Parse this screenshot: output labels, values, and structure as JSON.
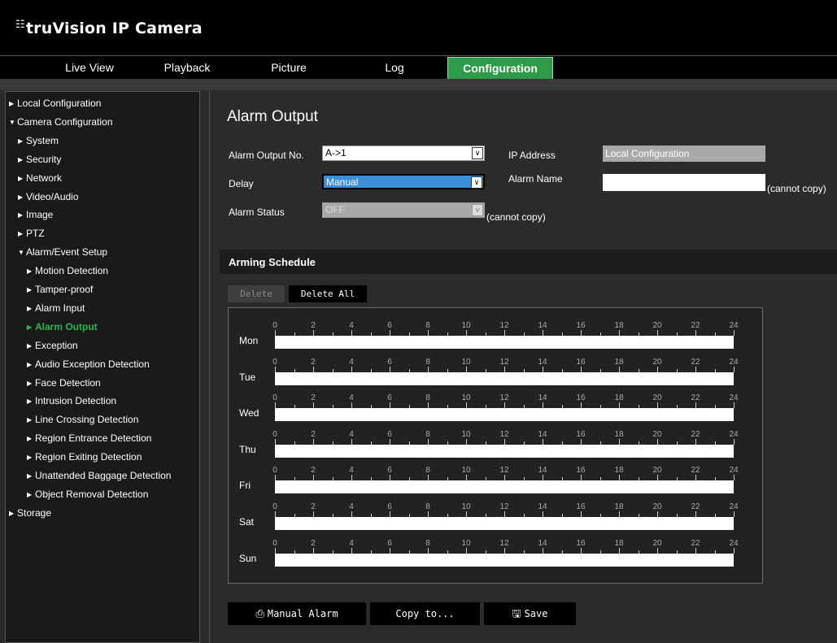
{
  "header": {
    "brand": "truVision IP Camera"
  },
  "nav": {
    "tabs": [
      "Live View",
      "Playback",
      "Picture",
      "Log",
      "Configuration"
    ],
    "active": "Configuration"
  },
  "sidebar": {
    "items": [
      {
        "label": "Local Configuration",
        "expanded": false,
        "level": 0
      },
      {
        "label": "Camera Configuration",
        "expanded": true,
        "level": 0
      },
      {
        "label": "System",
        "expanded": false,
        "level": 1
      },
      {
        "label": "Security",
        "expanded": false,
        "level": 1
      },
      {
        "label": "Network",
        "expanded": false,
        "level": 1
      },
      {
        "label": "Video/Audio",
        "expanded": false,
        "level": 1
      },
      {
        "label": "Image",
        "expanded": false,
        "level": 1
      },
      {
        "label": "PTZ",
        "expanded": false,
        "level": 1
      },
      {
        "label": "Alarm/Event Setup",
        "expanded": true,
        "level": 1
      },
      {
        "label": "Motion Detection",
        "expanded": false,
        "level": 2
      },
      {
        "label": "Tamper-proof",
        "expanded": false,
        "level": 2
      },
      {
        "label": "Alarm Input",
        "expanded": false,
        "level": 2
      },
      {
        "label": "Alarm Output",
        "expanded": false,
        "level": 2,
        "active": true
      },
      {
        "label": "Exception",
        "expanded": false,
        "level": 2
      },
      {
        "label": "Audio Exception Detection",
        "expanded": false,
        "level": 2
      },
      {
        "label": "Face Detection",
        "expanded": false,
        "level": 2
      },
      {
        "label": "Intrusion Detection",
        "expanded": false,
        "level": 2
      },
      {
        "label": "Line Crossing Detection",
        "expanded": false,
        "level": 2
      },
      {
        "label": "Region Entrance Detection",
        "expanded": false,
        "level": 2
      },
      {
        "label": "Region Exiting Detection",
        "expanded": false,
        "level": 2
      },
      {
        "label": "Unattended Baggage Detection",
        "expanded": false,
        "level": 2
      },
      {
        "label": "Object Removal Detection",
        "expanded": false,
        "level": 2
      },
      {
        "label": "Storage",
        "expanded": false,
        "level": 0
      }
    ]
  },
  "form": {
    "title": "Alarm Output",
    "alarm_output_no_label": "Alarm Output No.",
    "alarm_output_no_value": "A->1",
    "delay_label": "Delay",
    "delay_value": "Manual",
    "alarm_status_label": "Alarm Status",
    "alarm_status_value": "OFF",
    "ip_address_label": "IP Address",
    "ip_address_value": "Local Configuration",
    "alarm_name_label": "Alarm Name",
    "alarm_name_value": "",
    "cannot_copy_note": "(cannot copy)"
  },
  "schedule": {
    "section_title": "Arming Schedule",
    "delete_label": "Delete",
    "delete_all_label": "Delete All",
    "days": [
      "Mon",
      "Tue",
      "Wed",
      "Thu",
      "Fri",
      "Sat",
      "Sun"
    ],
    "hour_ticks": [
      "0",
      "2",
      "4",
      "6",
      "8",
      "10",
      "12",
      "14",
      "16",
      "18",
      "20",
      "22",
      "24"
    ]
  },
  "buttons": {
    "manual_alarm": "Manual Alarm",
    "copy_to": "Copy to...",
    "save": "Save"
  },
  "colors": {
    "accent": "#2e9b48",
    "active_text": "#2eb34d",
    "highlight": "#3b8fd8"
  },
  "icons": {
    "logo": "network-icon",
    "manual_alarm": "alarm-icon",
    "save": "floppy-disk-icon"
  }
}
